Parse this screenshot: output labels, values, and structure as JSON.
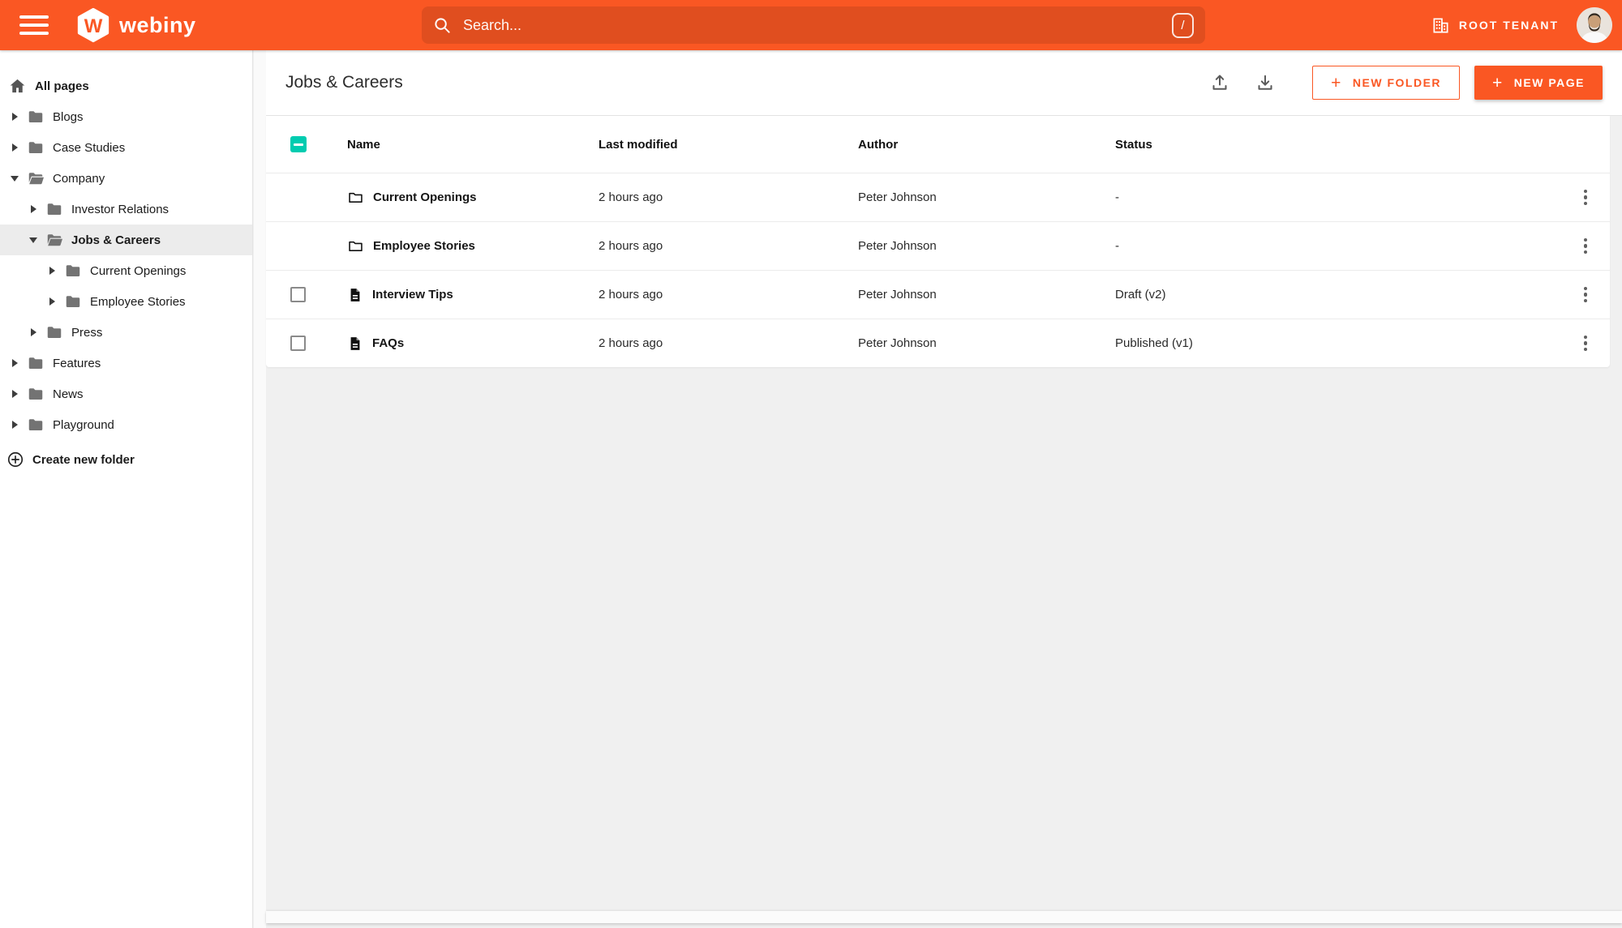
{
  "colors": {
    "brand_orange": "#fa5723",
    "checkbox_teal": "#00ccb0",
    "sidebar_selected_bg": "#ececec",
    "content_bg": "#f0f0f0"
  },
  "topbar": {
    "brand": "webiny",
    "search": {
      "placeholder": "Search...",
      "shortcut_key": "/"
    },
    "tenant_label": "ROOT TENANT"
  },
  "sidebar": {
    "root_label": "All pages",
    "items": [
      {
        "label": "Blogs"
      },
      {
        "label": "Case Studies"
      },
      {
        "label": "Company"
      },
      {
        "label": "Investor Relations"
      },
      {
        "label": "Jobs & Careers"
      },
      {
        "label": "Current Openings"
      },
      {
        "label": "Employee Stories"
      },
      {
        "label": "Press"
      },
      {
        "label": "Features"
      },
      {
        "label": "News"
      },
      {
        "label": "Playground"
      }
    ],
    "create_folder_label": "Create new folder"
  },
  "main": {
    "title": "Jobs & Careers",
    "new_folder_button": "NEW FOLDER",
    "new_page_button": "NEW PAGE",
    "table": {
      "columns": {
        "name": "Name",
        "modified": "Last modified",
        "author": "Author",
        "status": "Status"
      },
      "rows": [
        {
          "type": "folder",
          "name": "Current Openings",
          "modified": "2 hours ago",
          "author": "Peter Johnson",
          "status": "-"
        },
        {
          "type": "folder",
          "name": "Employee Stories",
          "modified": "2 hours ago",
          "author": "Peter Johnson",
          "status": "-"
        },
        {
          "type": "page",
          "name": "Interview Tips",
          "modified": "2 hours ago",
          "author": "Peter Johnson",
          "status": "Draft (v2)"
        },
        {
          "type": "page",
          "name": "FAQs",
          "modified": "2 hours ago",
          "author": "Peter Johnson",
          "status": "Published (v1)"
        }
      ]
    }
  }
}
